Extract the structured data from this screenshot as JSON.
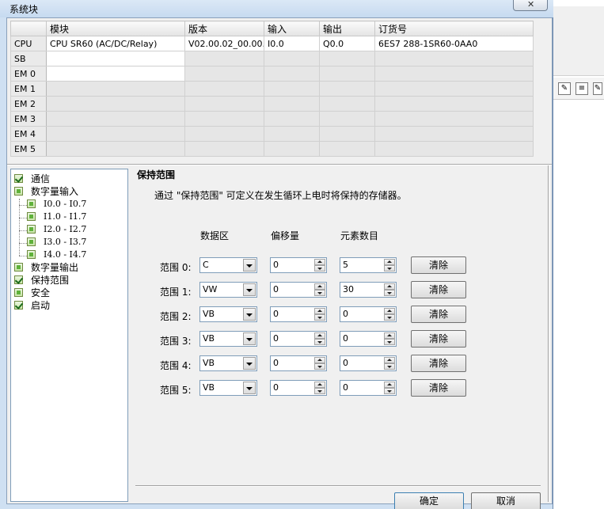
{
  "window": {
    "title": "系统块"
  },
  "module_table": {
    "headers": [
      "",
      "模块",
      "版本",
      "输入",
      "输出",
      "订货号"
    ],
    "rows": [
      {
        "slot": "CPU",
        "module": "CPU SR60 (AC/DC/Relay)",
        "version": "V02.00.02_00.00...",
        "input": "I0.0",
        "output": "Q0.0",
        "order": "6ES7 288-1SR60-0AA0"
      },
      {
        "slot": "SB",
        "module": "",
        "version": "",
        "input": "",
        "output": "",
        "order": ""
      },
      {
        "slot": "EM 0",
        "module": "",
        "version": "",
        "input": "",
        "output": "",
        "order": ""
      },
      {
        "slot": "EM 1",
        "module": "",
        "version": "",
        "input": "",
        "output": "",
        "order": ""
      },
      {
        "slot": "EM 2",
        "module": "",
        "version": "",
        "input": "",
        "output": "",
        "order": ""
      },
      {
        "slot": "EM 3",
        "module": "",
        "version": "",
        "input": "",
        "output": "",
        "order": ""
      },
      {
        "slot": "EM 4",
        "module": "",
        "version": "",
        "input": "",
        "output": "",
        "order": ""
      },
      {
        "slot": "EM 5",
        "module": "",
        "version": "",
        "input": "",
        "output": "",
        "order": ""
      }
    ]
  },
  "tree": {
    "items": [
      {
        "label": "通信",
        "state": "checked"
      },
      {
        "label": "数字量输入",
        "state": "square"
      },
      {
        "label": "I0.0 - I0.7",
        "state": "square"
      },
      {
        "label": "I1.0 - I1.7",
        "state": "square"
      },
      {
        "label": "I2.0 - I2.7",
        "state": "square"
      },
      {
        "label": "I3.0 - I3.7",
        "state": "square"
      },
      {
        "label": "I4.0 - I4.7",
        "state": "square"
      },
      {
        "label": "数字量输出",
        "state": "square"
      },
      {
        "label": "保持范围",
        "state": "checked"
      },
      {
        "label": "安全",
        "state": "square"
      },
      {
        "label": "启动",
        "state": "checked"
      }
    ]
  },
  "panel": {
    "title": "保持范围",
    "description": "通过 \"保持范围\" 可定义在发生循环上电时将保持的存储器。",
    "col_area": "数据区",
    "col_offset": "偏移量",
    "col_count": "元素数目",
    "clear_label": "清除",
    "ranges": [
      {
        "label": "范围 0:",
        "area": "C",
        "offset": "0",
        "count": "5"
      },
      {
        "label": "范围 1:",
        "area": "VW",
        "offset": "0",
        "count": "30"
      },
      {
        "label": "范围 2:",
        "area": "VB",
        "offset": "0",
        "count": "0"
      },
      {
        "label": "范围 3:",
        "area": "VB",
        "offset": "0",
        "count": "0"
      },
      {
        "label": "范围 4:",
        "area": "VB",
        "offset": "0",
        "count": "0"
      },
      {
        "label": "范围 5:",
        "area": "VB",
        "offset": "0",
        "count": "0"
      }
    ]
  },
  "buttons": {
    "ok": "确定",
    "cancel": "取消"
  }
}
